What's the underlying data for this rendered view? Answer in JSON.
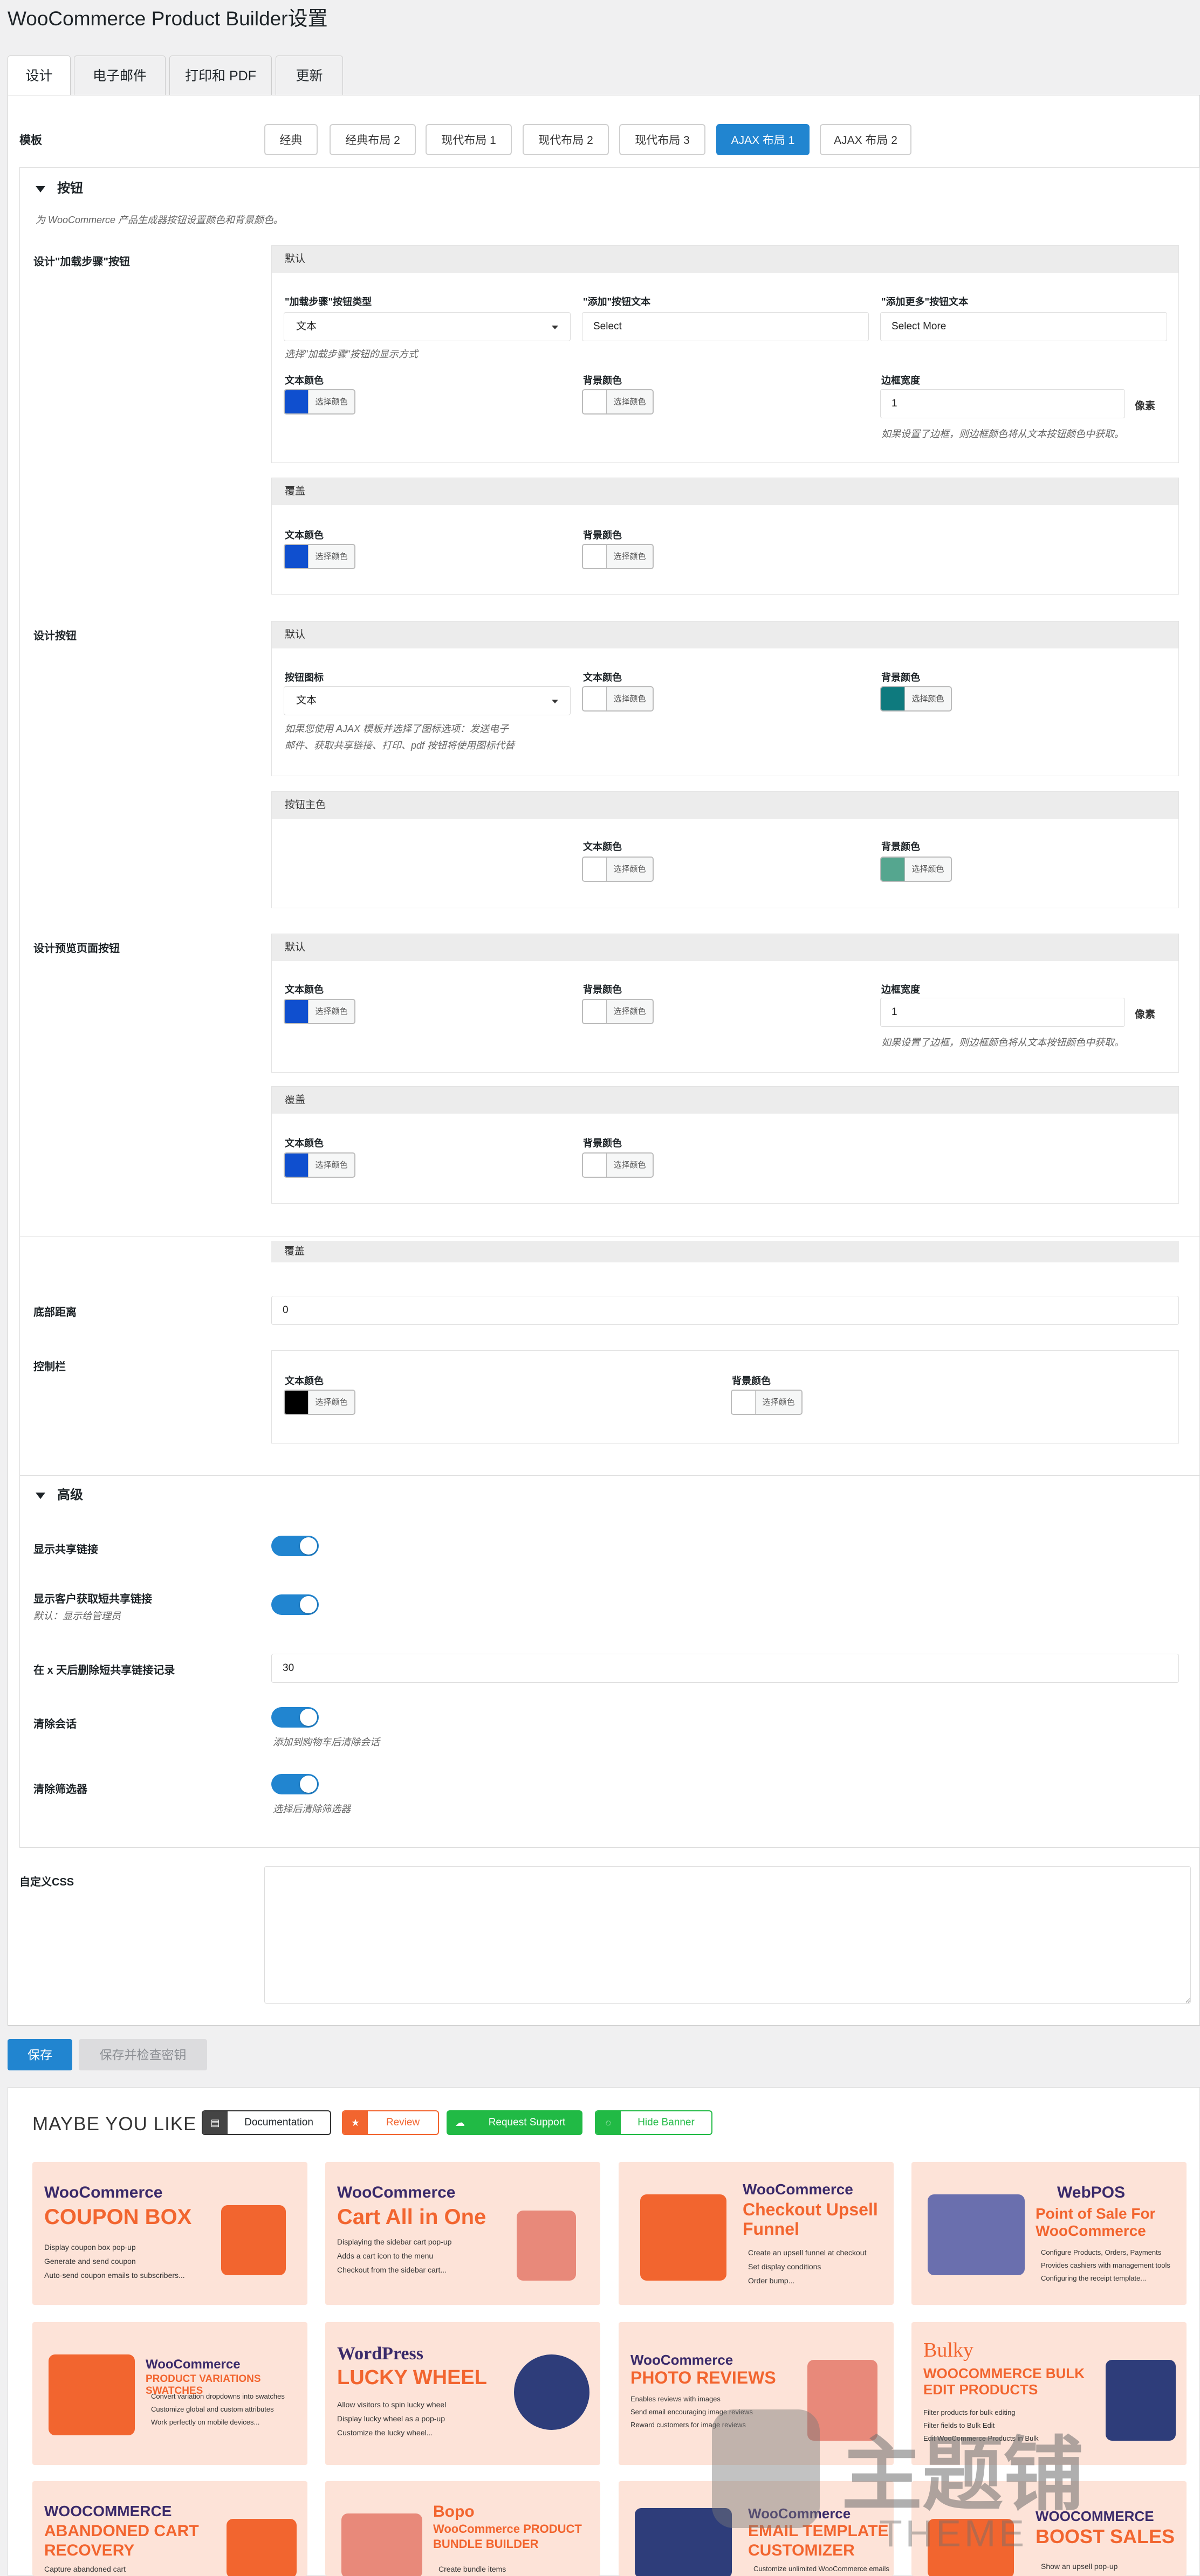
{
  "page_title": "WooCommerce Product Builder设置",
  "tabs": [
    {
      "label": "设计"
    },
    {
      "label": "电子邮件"
    },
    {
      "label": "打印和 PDF"
    },
    {
      "label": "更新"
    }
  ],
  "template": {
    "label": "模板",
    "options": [
      {
        "label": "经典"
      },
      {
        "label": "经典布局 2"
      },
      {
        "label": "现代布局 1"
      },
      {
        "label": "现代布局 2"
      },
      {
        "label": "现代布局 3"
      },
      {
        "label": "AJAX 布局 1"
      },
      {
        "label": "AJAX 布局 2"
      }
    ],
    "selected": "AJAX 布局 1"
  },
  "buttons_section": {
    "title": "按钮",
    "description": "为 WooCommerce 产品生成器按钮设置颜色和背景颜色。"
  },
  "pick_color": "选择颜色",
  "load_step": {
    "label": "设计\"加载步骤\"按钮",
    "default_head": "默认",
    "type_label": "\"加载步骤\"按钮类型",
    "type_value": "文本",
    "type_help": "选择\"加载步骤\"按钮的显示方式",
    "add_label": "\"添加\"按钮文本",
    "add_value": "Select",
    "more_label": "\"添加更多\"按钮文本",
    "more_value": "Select More",
    "text_color": "文本颜色",
    "bg_color": "背景颜色",
    "border_label": "边框宽度",
    "border_value": "1",
    "unit": "像素",
    "border_help": "如果设置了边框，则边框颜色将从文本按钮颜色中获取。",
    "hover_head": "覆盖",
    "hover_text_color": "文本颜色",
    "hover_bg_color": "背景颜色"
  },
  "design_button": {
    "label": "设计按钮",
    "default_head": "默认",
    "icon_label": "按钮图标",
    "icon_value": "文本",
    "icon_help": "如果您使用 AJAX 模板并选择了图标选项：发送电子邮件、获取共享链接、打印、pdf 按钮将使用图标代替",
    "text_color": "文本颜色",
    "bg_color": "背景颜色",
    "primary_head": "按钮主色",
    "primary_text_color": "文本颜色",
    "primary_bg_color": "背景颜色"
  },
  "preview_button": {
    "label": "设计预览页面按钮",
    "default_head": "默认",
    "text_color": "文本颜色",
    "bg_color": "背景颜色",
    "border_label": "边框宽度",
    "border_value": "1",
    "unit": "像素",
    "border_help": "如果设置了边框，则边框颜色将从文本按钮颜色中获取。",
    "hover_head": "覆盖",
    "hover_text_color": "文本颜色",
    "hover_bg_color": "背景颜色"
  },
  "overlay": {
    "head": "覆盖",
    "bottom_label": "底部距离",
    "bottom_value": "0",
    "controlbar_label": "控制栏",
    "text_color": "文本颜色",
    "bg_color": "背景颜色"
  },
  "advanced": {
    "title": "高级",
    "share_label": "显示共享链接",
    "customer_share_label": "显示客户获取短共享链接",
    "customer_share_sub": "默认：显示给管理员",
    "delete_label": "在 x 天后删除短共享链接记录",
    "delete_value": "30",
    "clear_session_label": "清除会话",
    "clear_session_help": "添加到购物车后清除会话",
    "clear_filter_label": "清除筛选器",
    "clear_filter_help": "选择后清除筛选器"
  },
  "custom_css": {
    "label": "自定义CSS",
    "value": ""
  },
  "actions": {
    "save": "保存",
    "save_check": "保存并检查密钥"
  },
  "banner": {
    "title": "MAYBE YOU LIKE",
    "buttons": [
      {
        "label": "Documentation"
      },
      {
        "label": "Review"
      },
      {
        "label": "Request Support"
      },
      {
        "label": "Hide Banner"
      }
    ]
  },
  "products": [
    {
      "l1": "WooCommerce",
      "l2": "COUPON BOX",
      "items": [
        "Display coupon box pop-up",
        "Generate and send coupon",
        "Auto-send coupon emails to subscribers..."
      ]
    },
    {
      "l1": "WooCommerce",
      "l2": "Cart All in One",
      "items": [
        "Displaying the sidebar cart pop-up",
        "Adds a cart icon to the menu",
        "Checkout from the sidebar cart..."
      ]
    },
    {
      "l1": "WooCommerce",
      "l2": "Checkout Upsell Funnel",
      "items": [
        "Create an upsell funnel at checkout",
        "Set display conditions",
        "Order bump..."
      ]
    },
    {
      "l1": "WebPOS",
      "l2": "Point of Sale For WooCommerce",
      "items": [
        "Configure Products, Orders, Payments",
        "Provides cashiers with management tools",
        "Configuring the receipt template..."
      ]
    },
    {
      "l1": "WooCommerce",
      "l2": "PRODUCT VARIATIONS SWATCHES",
      "items": [
        "Convert variation dropdowns into swatches",
        "Customize global and custom attributes",
        "Work perfectly on mobile devices..."
      ]
    },
    {
      "l1": "WordPress",
      "l2": "LUCKY WHEEL",
      "items": [
        "Allow visitors to spin lucky wheel",
        "Display lucky wheel as a pop-up",
        "Customize the lucky wheel..."
      ]
    },
    {
      "l1": "WooCommerce",
      "l2": "PHOTO REVIEWS",
      "items": [
        "Enables reviews with images",
        "Send email encouraging image reviews",
        "Reward customers for image reviews"
      ]
    },
    {
      "l1": "Bulky",
      "l2": "WOOCOMMERCE BULK EDIT PRODUCTS",
      "items": [
        "Filter products for bulk editing",
        "Filter fields to Bulk Edit",
        "Edit WooCommerce Products in Bulk"
      ]
    },
    {
      "l1": "WOOCOMMERCE",
      "l2": "ABANDONED CART RECOVERY",
      "items": [
        "Capture abandoned cart"
      ]
    },
    {
      "l1": "Bopo",
      "l2": "WooCommerce PRODUCT BUNDLE BUILDER",
      "items": [
        "Create bundle items"
      ]
    },
    {
      "l1": "WooCommerce",
      "l2": "EMAIL TEMPLATE CUSTOMIZER",
      "items": [
        "Customize unlimited WooCommerce emails"
      ]
    },
    {
      "l1": "WOOCOMMERCE",
      "l2": "BOOST SALES",
      "items": [
        "Show an upsell pop-up"
      ]
    }
  ],
  "watermark": "主题铺",
  "watermark_sub": "THEME",
  "colors": {
    "accent": "#2185d0",
    "blue_swatch": "#0f4fcf",
    "teal_swatch": "#0e7a7e",
    "teal_light_swatch": "#55a68f",
    "black_swatch": "#000000",
    "card_bg": "#fde3d8",
    "orange": "#f2652f"
  }
}
